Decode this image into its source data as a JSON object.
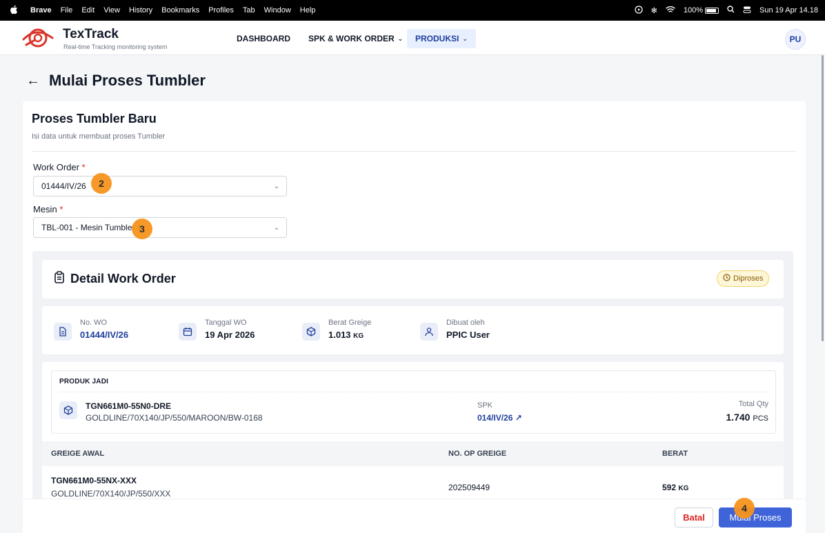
{
  "menubar": {
    "items": [
      "Brave",
      "File",
      "Edit",
      "View",
      "History",
      "Bookmarks",
      "Profiles",
      "Tab",
      "Window",
      "Help"
    ],
    "battery": "100%",
    "datetime": "Sun 19 Apr 14.18"
  },
  "header": {
    "brand": "TexTrack",
    "tagline": "Real-time Tracking monitoring system",
    "nav": [
      "DASHBOARD",
      "SPK & WORK ORDER",
      "PRODUKSI"
    ],
    "avatar": "PU",
    "accent": "#1f3f9c"
  },
  "page": {
    "back_icon": "arrow-left-icon",
    "title": "Mulai Proses Tumbler"
  },
  "form": {
    "title": "Proses Tumbler Baru",
    "subtitle": "Isi data untuk membuat proses Tumbler",
    "work_order_label": "Work Order",
    "work_order_value": "01444/IV/26",
    "mesin_label": "Mesin",
    "mesin_value": "TBL-001 - Mesin Tumbler 1",
    "required_mark": "*"
  },
  "detail": {
    "title": "Detail Work Order",
    "status": "Diproses",
    "no_wo_label": "No. WO",
    "no_wo": "01444/IV/26",
    "tanggal_label": "Tanggal WO",
    "tanggal": "19 Apr 2026",
    "berat_label": "Berat Greige",
    "berat": "1.013",
    "berat_unit": "KG",
    "dibuat_label": "Dibuat oleh",
    "dibuat": "PPIC User"
  },
  "produk_jadi": {
    "label": "PRODUK JADI",
    "code": "TGN661M0-55N0-DRE",
    "desc": "GOLDLINE/70X140/JP/550/MAROON/BW-0168",
    "spk_label": "SPK",
    "spk": "014/IV/26 ↗",
    "total_label": "Total Qty",
    "total": "1.740",
    "total_unit": "PCS"
  },
  "greige_table": {
    "headers": [
      "GREIGE AWAL",
      "NO. OP GREIGE",
      "BERAT"
    ],
    "rows": [
      {
        "code": "TGN661M0-55NX-XXX",
        "desc": "GOLDLINE/70X140/JP/550/XXX",
        "no_op": "202509449",
        "berat": "592",
        "unit": "KG"
      }
    ]
  },
  "actions": {
    "batal": "Batal",
    "mulai": "Mulai Proses"
  },
  "markers": [
    "2",
    "3",
    "4"
  ]
}
